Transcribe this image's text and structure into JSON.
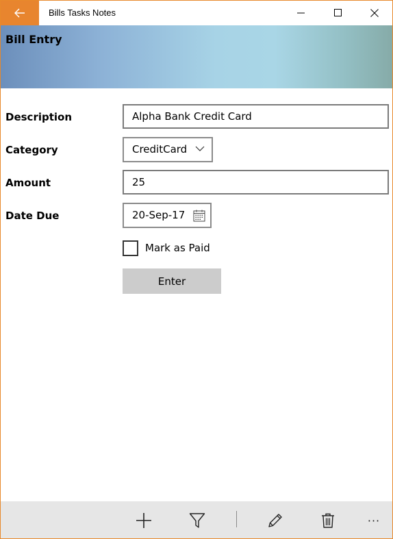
{
  "window": {
    "title": "Bills Tasks Notes",
    "accent_color": "#e8852e"
  },
  "header": {
    "title": "Bill Entry"
  },
  "form": {
    "description": {
      "label": "Description",
      "value": "Alpha Bank Credit Card"
    },
    "category": {
      "label": "Category",
      "selected": "CreditCard"
    },
    "amount": {
      "label": "Amount",
      "value": "25"
    },
    "date_due": {
      "label": "Date Due",
      "value": "20-Sep-17"
    },
    "mark_paid": {
      "label": "Mark as Paid",
      "checked": false
    },
    "enter_label": "Enter"
  },
  "commandbar": {
    "icons": [
      "add-icon",
      "filter-icon",
      "edit-icon",
      "delete-icon",
      "more-icon"
    ],
    "more_glyph": "···"
  }
}
